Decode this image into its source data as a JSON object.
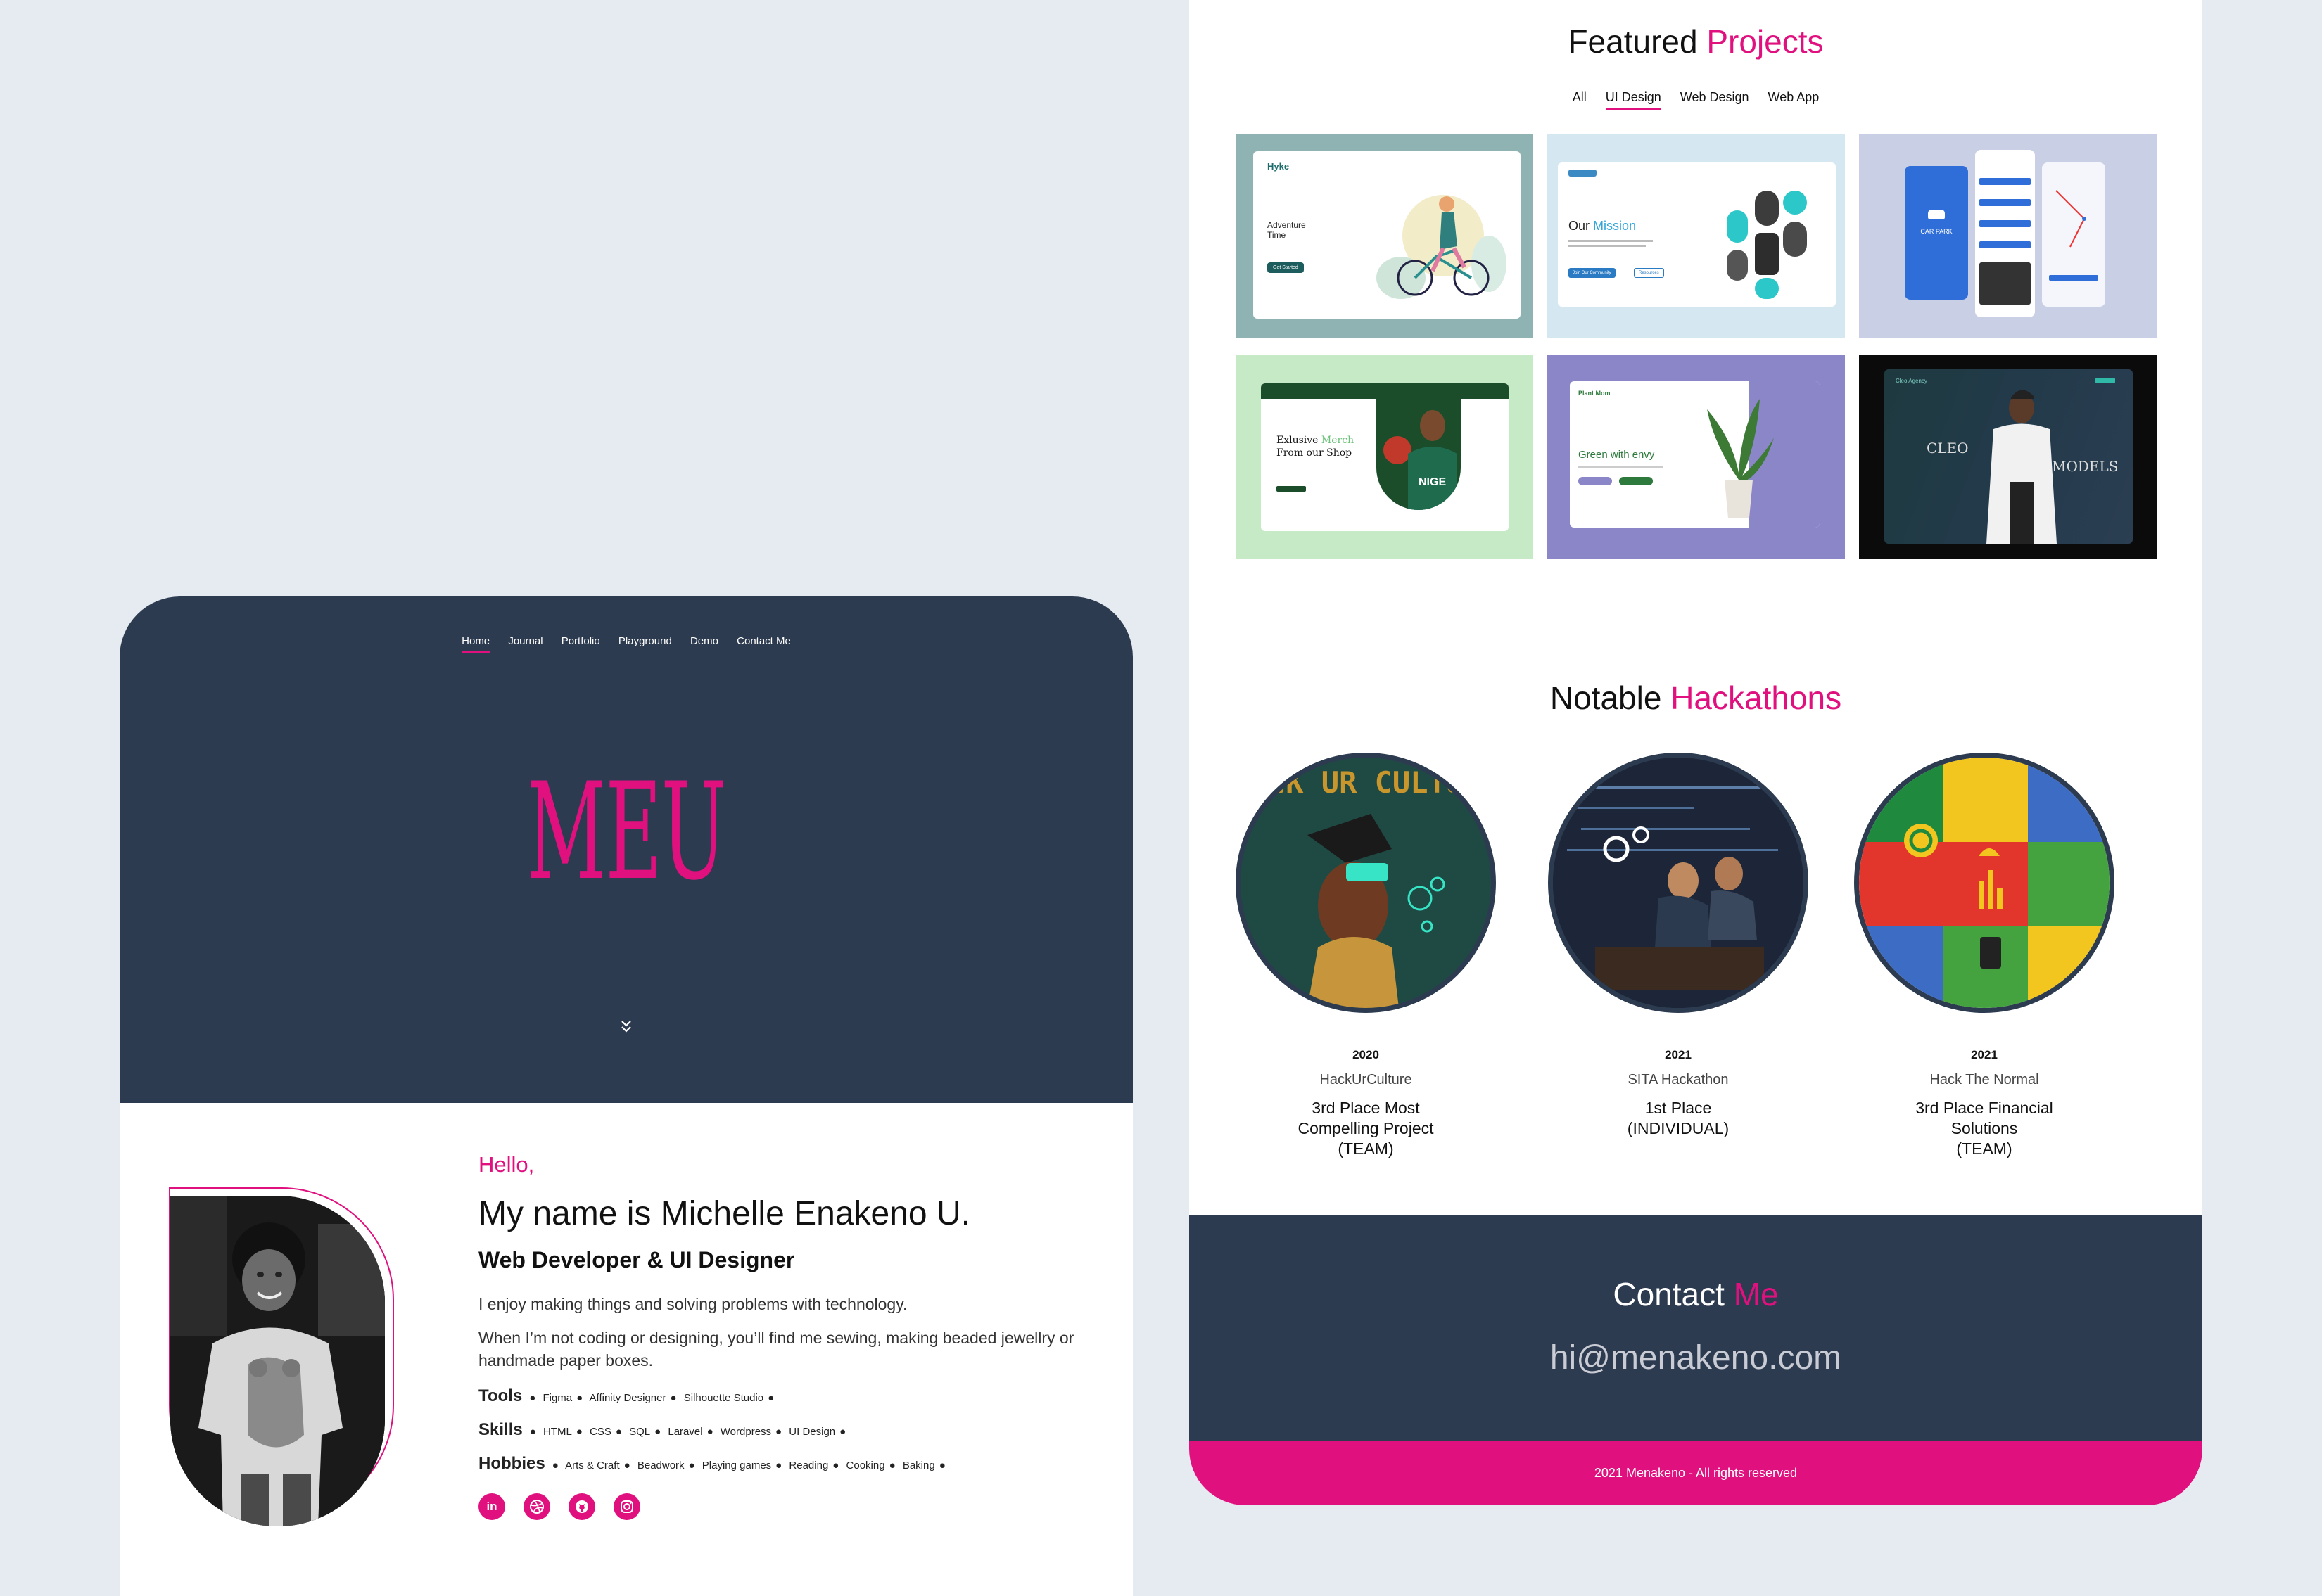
{
  "nav": {
    "items": [
      "Home",
      "Journal",
      "Portfolio",
      "Playground",
      "Demo",
      "Contact Me"
    ],
    "active": "Home"
  },
  "hero": {
    "logo": "MEU"
  },
  "about": {
    "hello": "Hello,",
    "name": "My name is Michelle Enakeno U.",
    "role": "Web Developer & UI Designer",
    "para1": "I enjoy making things and solving problems with technology.",
    "para2": "When I’m not coding or designing, you’ll find me sewing, making beaded jewellry or handmade paper boxes.",
    "tools_label": "Tools",
    "tools": [
      "Figma",
      "Affinity Designer",
      "Silhouette Studio"
    ],
    "skills_label": "Skills",
    "skills": [
      "HTML",
      "CSS",
      "SQL",
      "Laravel",
      "Wordpress",
      "UI Design"
    ],
    "hobbies_label": "Hobbies",
    "hobbies": [
      "Arts & Craft",
      "Beadwork",
      "Playing games",
      "Reading",
      "Cooking",
      "Baking"
    ],
    "socials": [
      "linkedin-icon",
      "dribbble-icon",
      "github-icon",
      "instagram-icon"
    ]
  },
  "projects": {
    "title_a": "Featured",
    "title_b": "Projects",
    "filters": [
      "All",
      "UI Design",
      "Web Design",
      "Web App"
    ],
    "active_filter": "UI Design",
    "tiles": [
      {
        "bg": "#8fb3b3",
        "heading": "Adventure Time",
        "brand": "Hyke",
        "button": "Get Started"
      },
      {
        "bg": "#d5e8f1",
        "heading_a": "Our",
        "heading_b": "Mission",
        "btn1": "Join Our Community",
        "btn2": "Resources"
      },
      {
        "bg": "#c9d0e6",
        "label": "CAR PARK"
      },
      {
        "bg": "#c6eac6",
        "heading_a": "Exlusive",
        "heading_b": "Merch",
        "heading_c": "From our Shop",
        "jersey": "NIGE"
      },
      {
        "bg": "#8b86c8",
        "brand": "Plant Mom",
        "heading": "Green with envy"
      },
      {
        "bg": "#0b0b0b",
        "brand": "Cleo Agency",
        "word_a": "CLEO",
        "word_b": "MODELS"
      }
    ]
  },
  "hackathons": {
    "title_a": "Notable",
    "title_b": "Hackathons",
    "items": [
      {
        "year": "2020",
        "org": "HackUrCulture",
        "award": "3rd Place Most\nCompelling Project\n(TEAM)",
        "art": "HACK UR CULTURE"
      },
      {
        "year": "2021",
        "org": "SITA Hackathon",
        "award": "1st Place\n(INDIVIDUAL)"
      },
      {
        "year": "2021",
        "org": "Hack The Normal",
        "award": "3rd Place Financial\nSolutions\n(TEAM)"
      }
    ]
  },
  "contact": {
    "title_a": "Contact",
    "title_b": "Me",
    "email": "hi@menakeno.com"
  },
  "footer": {
    "text": "2021 Menakeno - All rights reserved"
  },
  "colors": {
    "accent": "#e0117f",
    "navy": "#2d3b50",
    "background": "#e6eaf1"
  }
}
